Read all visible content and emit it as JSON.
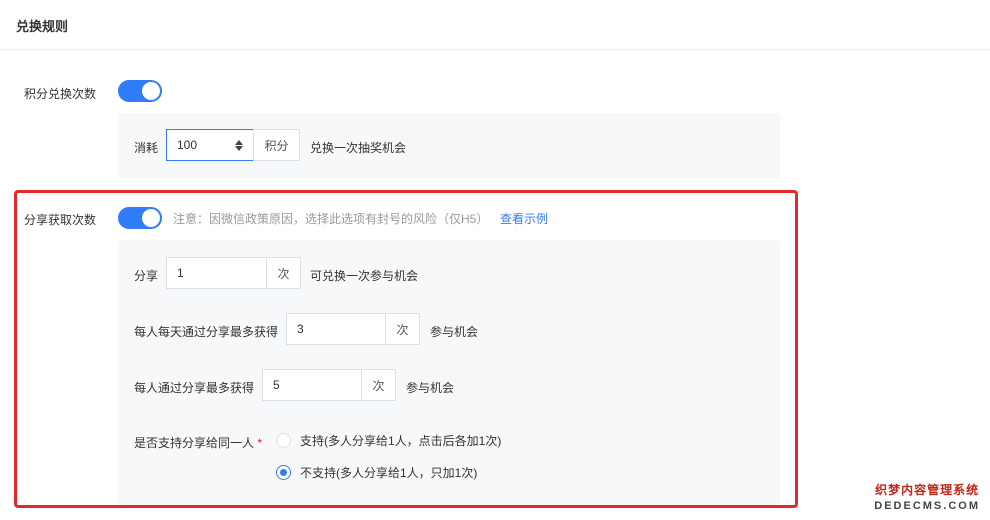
{
  "section_title": "兑换规则",
  "points_exchange": {
    "label": "积分兑换次数",
    "enabled": true,
    "consume_label": "消耗",
    "value": "100",
    "unit": "积分",
    "suffix": "兑换一次抽奖机会"
  },
  "share_exchange": {
    "label": "分享获取次数",
    "enabled": true,
    "notice": "注意：因微信政策原因，选择此选项有封号的风险（仅H5）",
    "view_example": "查看示例",
    "share_row": {
      "label": "分享",
      "value": "1",
      "unit": "次",
      "suffix": "可兑换一次参与机会"
    },
    "daily_max_row": {
      "label": "每人每天通过分享最多获得",
      "value": "3",
      "unit": "次",
      "suffix": "参与机会"
    },
    "total_max_row": {
      "label": "每人通过分享最多获得",
      "value": "5",
      "unit": "次",
      "suffix": "参与机会"
    },
    "same_person": {
      "label": "是否支持分享给同一人",
      "required_mark": "*",
      "options": [
        {
          "label": "支持(多人分享给1人，点击后各加1次)",
          "selected": false
        },
        {
          "label": "不支持(多人分享给1人，只加1次)",
          "selected": true
        }
      ]
    }
  },
  "watermark": {
    "line1": "织梦内容管理系统",
    "line2": "DEDECMS.COM"
  },
  "colors": {
    "accent": "#2f7cf6",
    "highlight_border": "#e5292a",
    "required": "#e02020"
  }
}
